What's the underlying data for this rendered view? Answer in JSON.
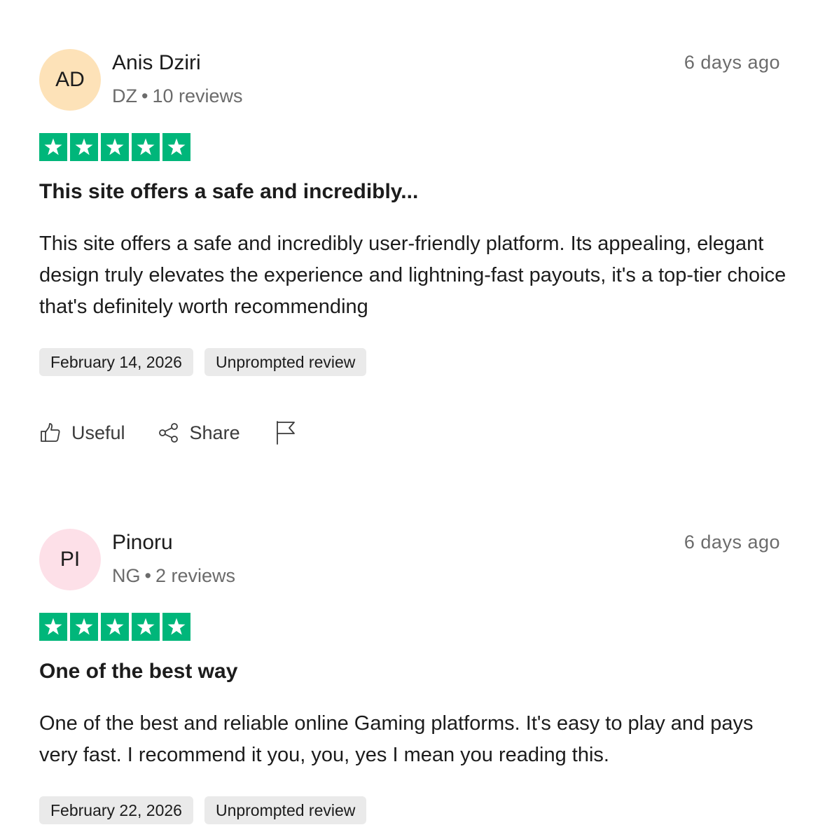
{
  "reviews": [
    {
      "initials": "AD",
      "avatar_color": "#fde2b8",
      "name": "Anis Dziri",
      "country": "DZ",
      "review_count": "10 reviews",
      "time_ago": "6 days ago",
      "rating": 5,
      "rating_max": 5,
      "star_color": "#00b67a",
      "title": "This site offers a safe and incredibly...",
      "body": "This site offers a safe and incredibly user-friendly platform. Its appealing, elegant design truly elevates the experience and lightning-fast payouts, it's a top-tier choice that's definitely worth recommending",
      "date": "February 14, 2026",
      "tag": "Unprompted review",
      "actions": {
        "useful_label": "Useful",
        "share_label": "Share",
        "useful_icon": "thumbs-up-icon",
        "share_icon": "share-icon",
        "report_icon": "flag-icon"
      }
    },
    {
      "initials": "PI",
      "avatar_color": "#fde0e8",
      "name": "Pinoru",
      "country": "NG",
      "review_count": "2 reviews",
      "time_ago": "6 days ago",
      "rating": 5,
      "rating_max": 5,
      "star_color": "#00b67a",
      "title": "One of the best way",
      "body": "One of the best and reliable online Gaming platforms. It's easy to play and pays very fast. I recommend it you, you, yes I mean you reading this.",
      "date": "February 22, 2026",
      "tag": "Unprompted review"
    }
  ],
  "separator": "•"
}
